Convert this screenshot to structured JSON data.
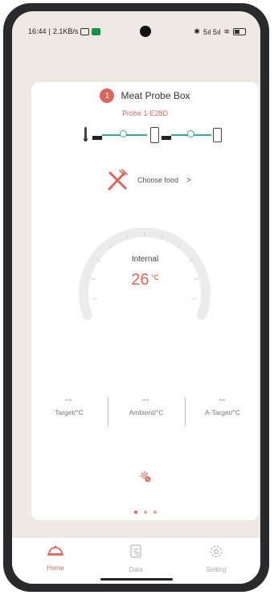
{
  "status_bar": {
    "time": "16:44",
    "net_speed": "2.1KB/s",
    "signal_text": "5ıl 5ıl",
    "icons": [
      "alarm-icon",
      "app-notification-icon",
      "bluetooth-icon",
      "signal-icon",
      "wifi-icon",
      "battery-icon"
    ]
  },
  "device": {
    "badge": "1",
    "title": "Meat Probe Box",
    "probe_id": "Probe 1-E28D",
    "connection_icons": [
      "thermometer-probe-icon",
      "box-icon",
      "phone-icon"
    ]
  },
  "food": {
    "label": "Choose food",
    "chevron": ">"
  },
  "gauge": {
    "label": "Internal",
    "temperature": "26",
    "unit": "℃"
  },
  "stats": [
    {
      "value": "--",
      "label": "Target/°C"
    },
    {
      "value": "--",
      "label": "Ambient/°C"
    },
    {
      "value": "--",
      "label": "A-Target/°C"
    }
  ],
  "pager": {
    "count": 3,
    "active": 0
  },
  "tabs": [
    {
      "label": "Home",
      "icon": "bbq-cover-icon",
      "active": true
    },
    {
      "label": "Data",
      "icon": "data-icon",
      "active": false
    },
    {
      "label": "Setting",
      "icon": "gear-icon",
      "active": false
    }
  ],
  "colors": {
    "accent": "#d9675c",
    "teal": "#3da89a",
    "background": "#efe9e3"
  }
}
